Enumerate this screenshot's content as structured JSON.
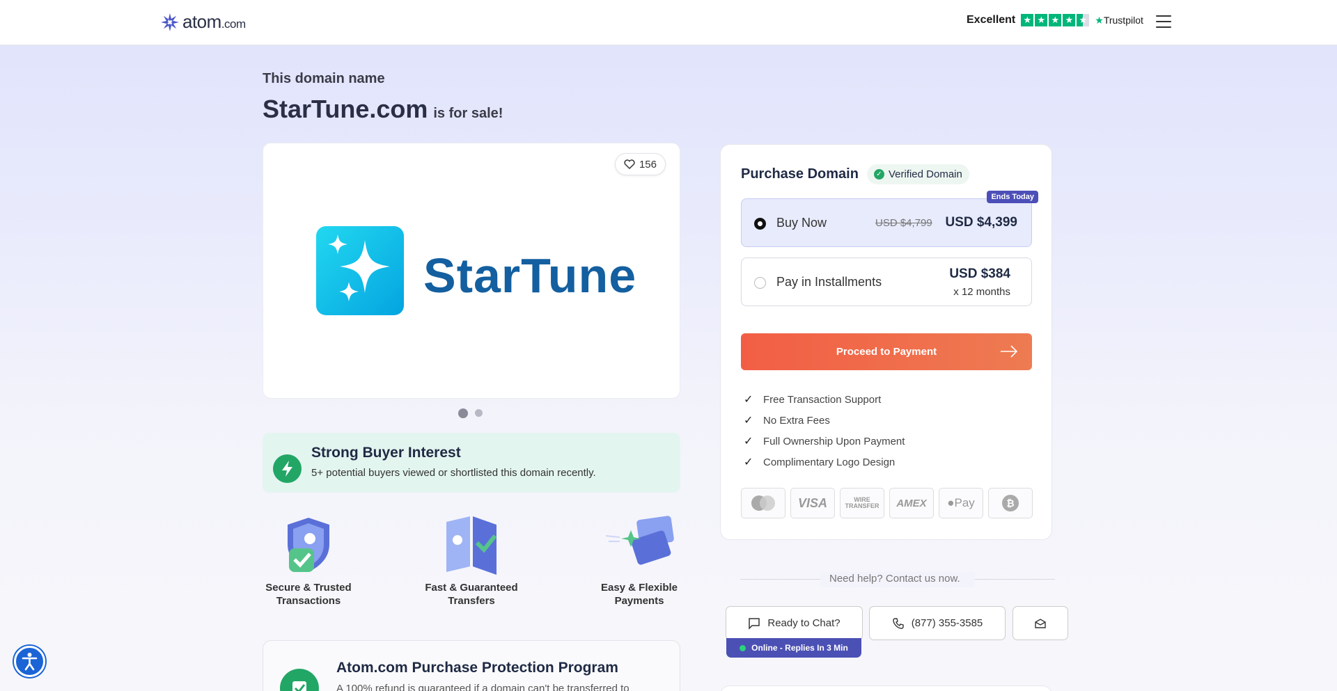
{
  "header": {
    "logo_text": "atom",
    "logo_suffix": ".com",
    "trustpilot_rating_label": "Excellent",
    "trustpilot_brand": "Trustpilot",
    "trustpilot_stars": 4.5,
    "colors": {
      "trustpilot_green": "#00b67a"
    }
  },
  "hero": {
    "subhead": "This domain name",
    "domain": "StarTune.com",
    "suffix": "is for sale!"
  },
  "logo_card": {
    "likes": "156",
    "brand_name": "StarTune",
    "slides_total": 2,
    "active_slide": 1
  },
  "interest": {
    "title": "Strong Buyer Interest",
    "subtitle": "5+ potential buyers viewed or shortlisted this domain recently."
  },
  "features": [
    {
      "label": "Secure & Trusted Transactions"
    },
    {
      "label": "Fast & Guaranteed Transfers"
    },
    {
      "label": "Easy & Flexible Payments"
    }
  ],
  "protection": {
    "title": "Atom.com Purchase Protection Program",
    "text": "A 100% refund is guaranteed if a domain can't be transferred to"
  },
  "purchase": {
    "title": "Purchase Domain",
    "verified_label": "Verified Domain",
    "ends_badge": "Ends Today",
    "buy_now": {
      "label": "Buy Now",
      "old_price": "USD $4,799",
      "price": "USD $4,399",
      "selected": true
    },
    "installments": {
      "label": "Pay in Installments",
      "price": "USD $384",
      "term": "x 12 months",
      "selected": false
    },
    "proceed_label": "Proceed to Payment",
    "benefits": [
      "Free Transaction Support",
      "No Extra Fees",
      "Full Ownership Upon Payment",
      "Complimentary Logo Design"
    ],
    "payment_methods": [
      {
        "icon": "mastercard-icon"
      },
      {
        "label": "VISA",
        "icon": "visa-icon"
      },
      {
        "label": "WIRE TRANSFER",
        "icon": "wire-transfer-icon"
      },
      {
        "label": "AMEX",
        "icon": "amex-icon"
      },
      {
        "label": "Pay",
        "icon": "apple-pay-icon"
      },
      {
        "icon": "bitcoin-icon"
      }
    ],
    "colors": {
      "proceed_start": "#f25e44",
      "proceed_end": "#ee7b52",
      "accent": "#4b50b4"
    }
  },
  "help": {
    "heading": "Need help? Contact us now.",
    "chat_label": "Ready to Chat?",
    "phone": "(877) 355-3585",
    "online_status": "Online - Replies In 3 Min"
  }
}
